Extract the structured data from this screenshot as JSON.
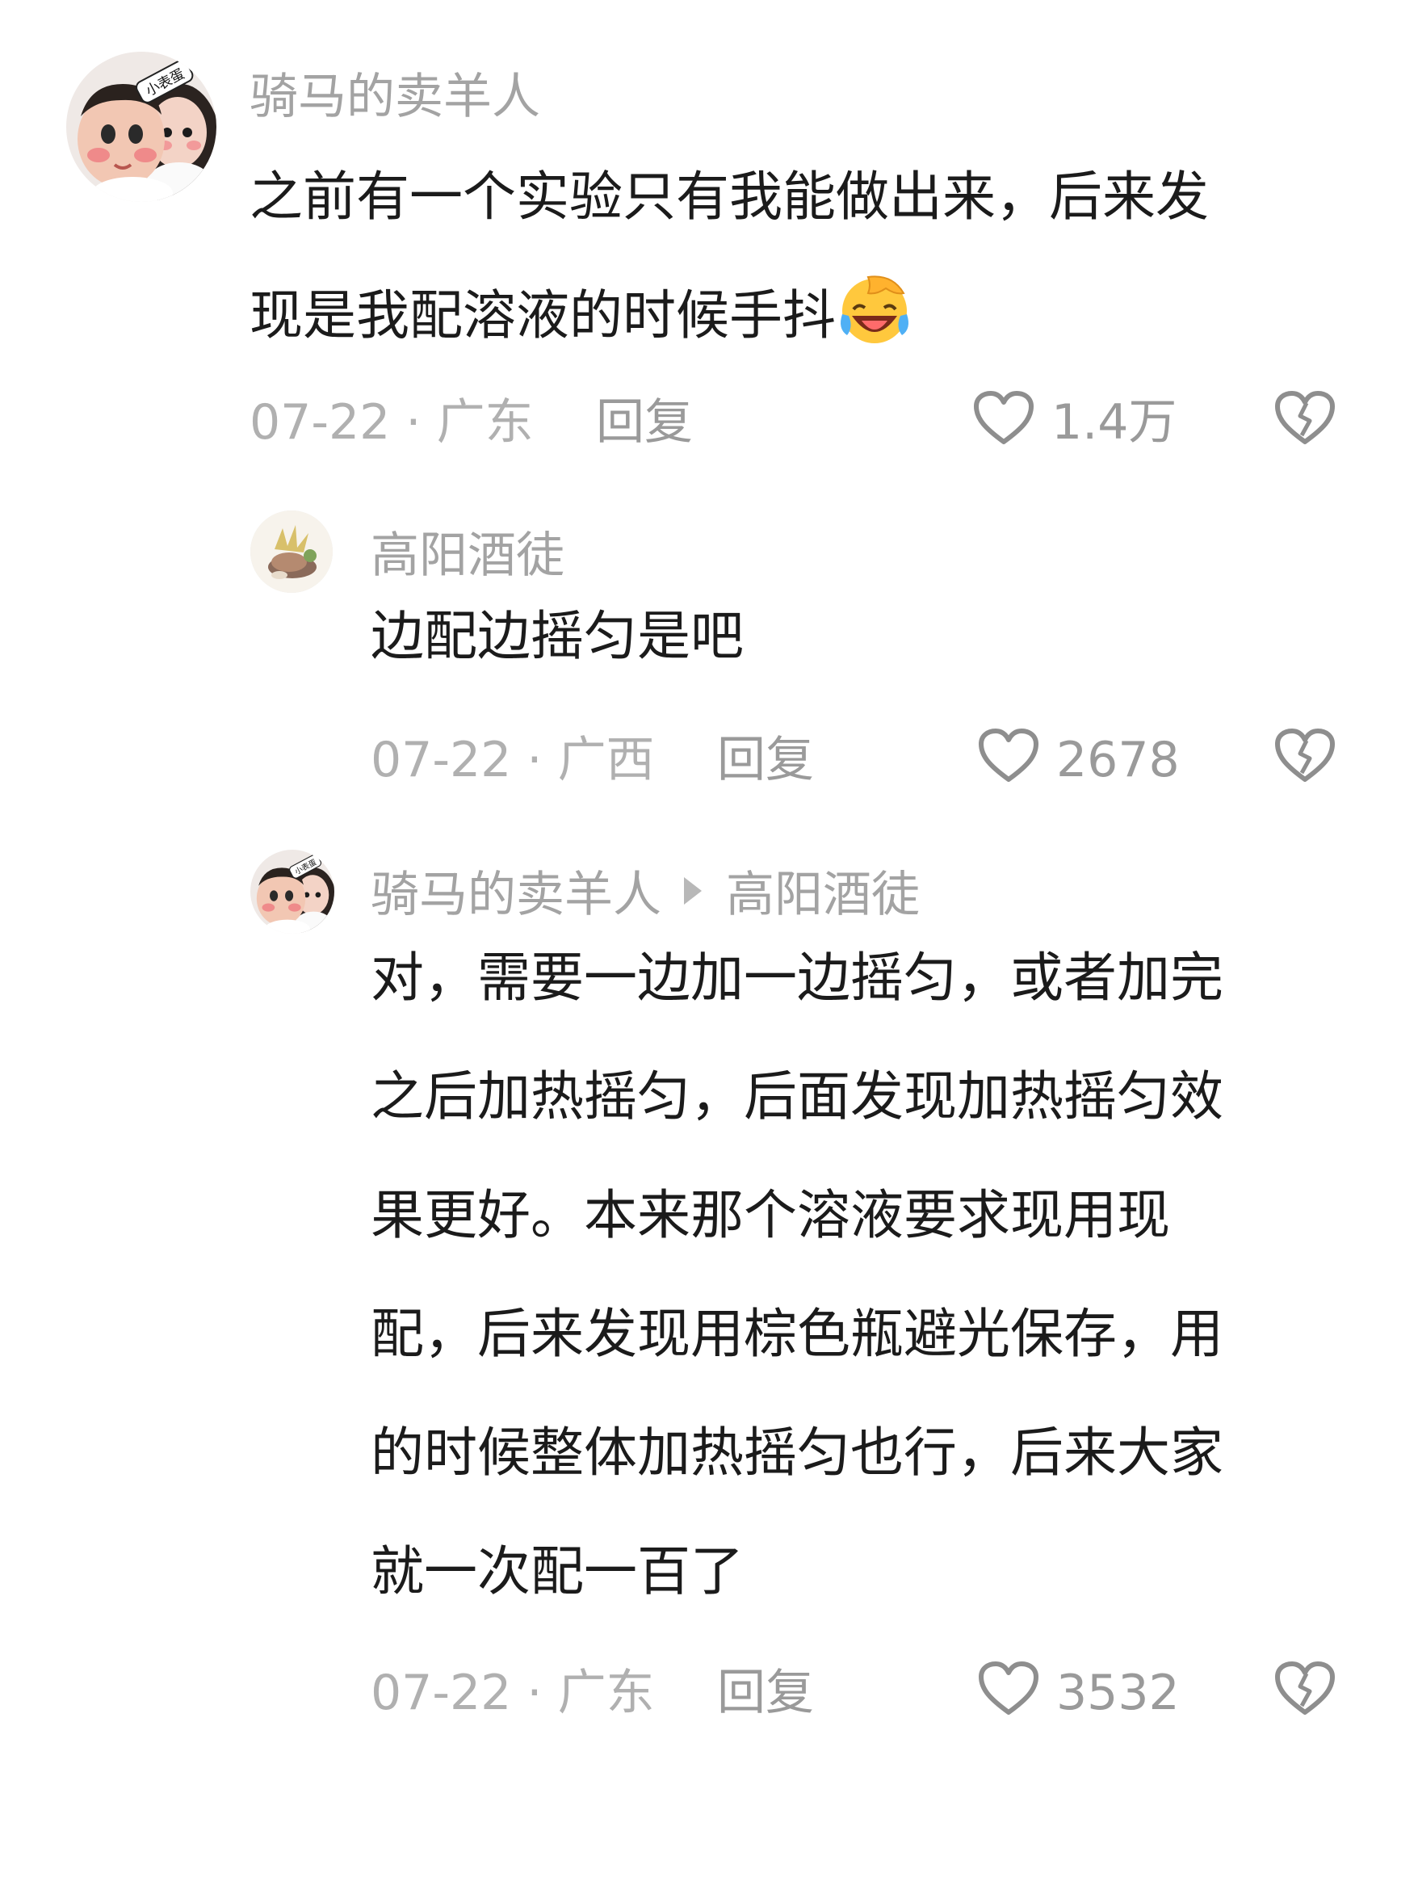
{
  "comments": [
    {
      "username": "骑马的卖羊人",
      "lines": [
        "之前有一个实验只有我能做出来，后来发",
        "现是我配溶液的时候手抖"
      ],
      "emoji": "laughing-crying-face-emoji",
      "date_location": "07-22 · 广东",
      "reply_label": "回复",
      "likes": "1.4万",
      "avatar_badge": "小表蛋"
    },
    {
      "username": "高阳酒徒",
      "lines": [
        "边配边摇匀是吧"
      ],
      "date_location": "07-22 · 广西",
      "reply_label": "回复",
      "likes": "2678"
    },
    {
      "username": "骑马的卖羊人",
      "reply_to": "高阳酒徒",
      "lines": [
        "对，需要一边加一边摇匀，或者加完",
        "之后加热摇匀，后面发现加热摇匀效",
        "果更好。本来那个溶液要求现用现",
        "配，后来发现用棕色瓶避光保存，用",
        "的时候整体加热摇匀也行，后来大家",
        "就一次配一百了"
      ],
      "date_location": "07-22 · 广东",
      "reply_label": "回复",
      "likes": "3532",
      "avatar_badge": "小表蛋"
    }
  ],
  "colors": {
    "text": "#1b1b1b",
    "username": "#a3a3a3",
    "meta": "#b0b0b0",
    "icon": "#8e8e8e",
    "background": "#ffffff"
  }
}
